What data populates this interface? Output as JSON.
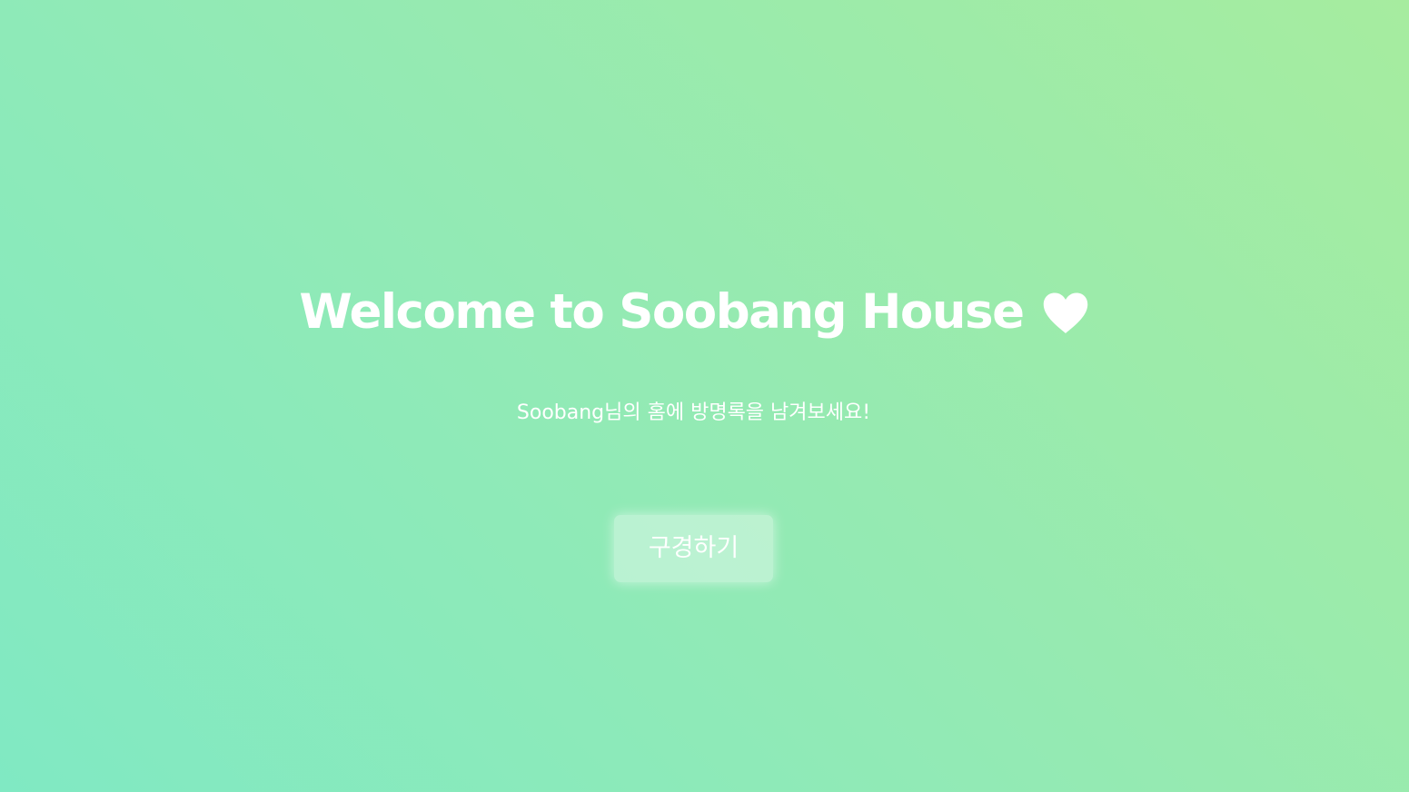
{
  "hero": {
    "title": "Welcome to Soobang House",
    "heart_icon": "heart-icon",
    "subtitle": "Soobang님의 홈에 방명록을 남겨보세요!",
    "cta_label": "구경하기"
  },
  "colors": {
    "background_start": "#80e9c3",
    "background_end": "#a6ec9f",
    "text": "#ffffff"
  }
}
